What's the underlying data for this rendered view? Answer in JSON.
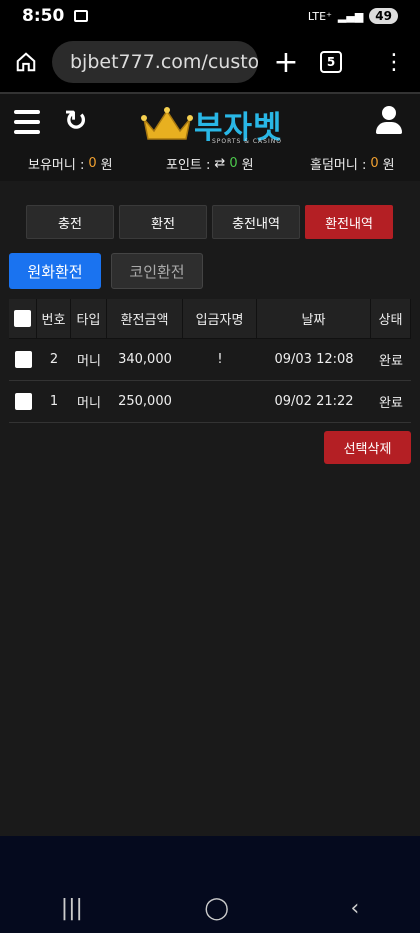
{
  "status": {
    "time": "8:50",
    "network": "LTE⁺",
    "battery": "49"
  },
  "browser": {
    "url": "bjbet777.com/custo",
    "tab_count": "5"
  },
  "site": {
    "logo_text": "부자벳",
    "logo_sub": "SPORTS & CASINO",
    "money": {
      "balance_label": "보유머니 :",
      "balance_value": "0",
      "balance_unit": "원",
      "point_label": "포인트 :",
      "point_value": "0",
      "point_unit": "원",
      "holdem_label": "홀덤머니 :",
      "holdem_value": "0",
      "holdem_unit": "원"
    }
  },
  "tabs": [
    "충전",
    "환전",
    "충전내역",
    "환전내역"
  ],
  "sub_tabs": [
    "원화환전",
    "코인환전"
  ],
  "table": {
    "headers": [
      "번호",
      "타입",
      "환전금액",
      "입금자명",
      "날짜",
      "상태"
    ],
    "rows": [
      {
        "no": "2",
        "type": "머니",
        "amount": "340,000",
        "name": "!",
        "date": "09/03 12:08",
        "status": "완료"
      },
      {
        "no": "1",
        "type": "머니",
        "amount": "250,000",
        "name": "",
        "date": "09/02 21:22",
        "status": "완료"
      }
    ]
  },
  "delete_label": "선택삭제",
  "colors": {
    "accent_red": "#b41f24",
    "accent_blue": "#1a73f0",
    "logo_blue": "#29b7e6"
  }
}
